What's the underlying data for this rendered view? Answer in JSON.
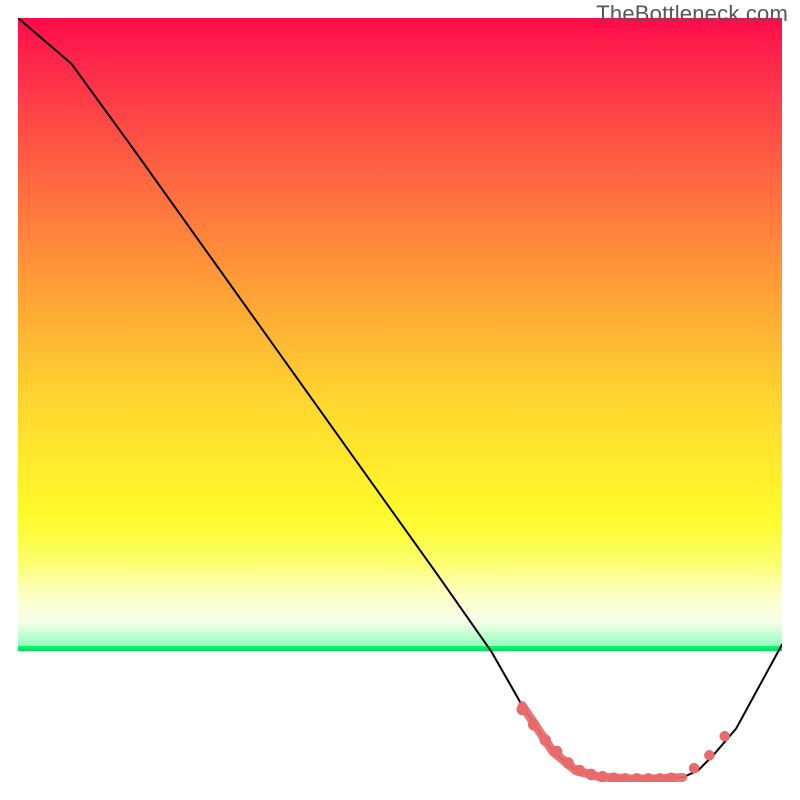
{
  "watermark": "TheBottleneck.com",
  "colors": {
    "curve_stroke": "#000000",
    "marker_fill": "#e86a6a",
    "marker_stroke": "#d85b5b"
  },
  "chart_data": {
    "type": "line",
    "title": "",
    "xlabel": "",
    "ylabel": "",
    "xlim": [
      0,
      100
    ],
    "ylim": [
      0,
      100
    ],
    "grid": false,
    "legend": false,
    "series": [
      {
        "name": "bottleneck-curve",
        "x": [
          0,
          7,
          15,
          25,
          35,
          45,
          55,
          62,
          66,
          70,
          73,
          76,
          80,
          84,
          87,
          89,
          91,
          94,
          100
        ],
        "y": [
          100,
          94,
          83,
          69,
          55,
          41,
          27,
          17,
          10,
          4,
          1.5,
          0.7,
          0.4,
          0.4,
          0.6,
          1.5,
          3.5,
          7,
          18
        ]
      }
    ],
    "markers": {
      "name": "flat-segment-points",
      "x": [
        66,
        67.5,
        69,
        70.5,
        72,
        73.5,
        75,
        76.5,
        78,
        79.5,
        81,
        82.5,
        84,
        85.5,
        88.5,
        90.5,
        92.5
      ],
      "y": [
        9.5,
        7.5,
        5.5,
        4,
        2.5,
        1.5,
        1,
        0.7,
        0.5,
        0.4,
        0.4,
        0.4,
        0.4,
        0.5,
        1.8,
        3.5,
        6.0
      ]
    }
  }
}
